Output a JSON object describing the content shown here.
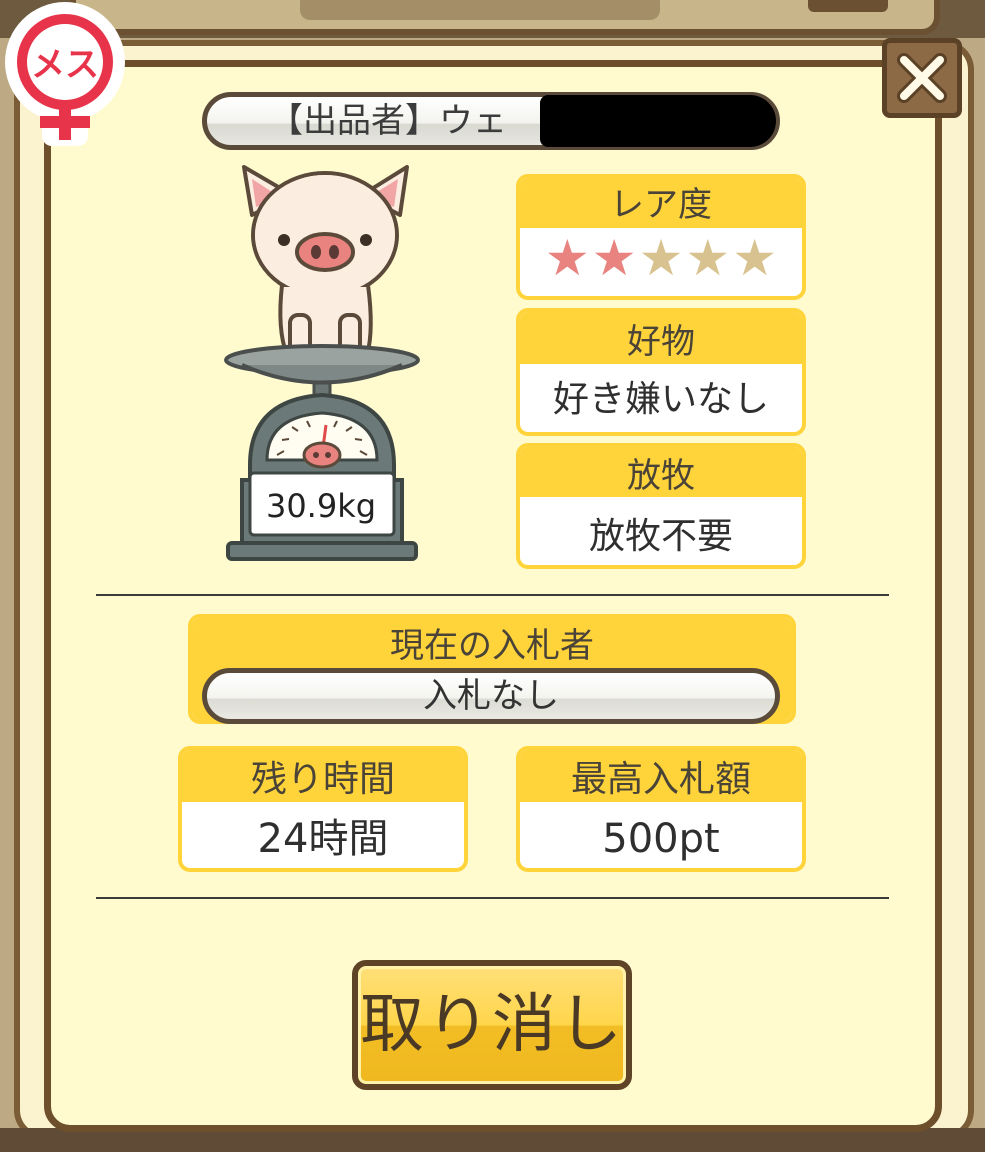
{
  "seller": {
    "label": "【出品者】ウェ"
  },
  "gender_badge": {
    "label": "メス"
  },
  "weight": {
    "value": "30.9kg"
  },
  "rarity": {
    "title": "レア度",
    "stars_filled": 2,
    "stars_total": 5,
    "filled_color": "#e8837f",
    "empty_color": "#d8c28f"
  },
  "favorite": {
    "title": "好物",
    "value": "好き嫌いなし"
  },
  "grazing": {
    "title": "放牧",
    "value": "放牧不要"
  },
  "current_bidder": {
    "title": "現在の入札者",
    "value": "入札なし"
  },
  "time_left": {
    "title": "残り時間",
    "value": "24時間"
  },
  "highest_bid": {
    "title": "最高入札額",
    "value": "500pt"
  },
  "cancel_button": {
    "label": "取り消し"
  },
  "colors": {
    "accent_yellow": "#ffd43a",
    "panel_bg": "#fffbcf",
    "frame_brown": "#6e4f2c",
    "badge_red": "#e8344a"
  }
}
